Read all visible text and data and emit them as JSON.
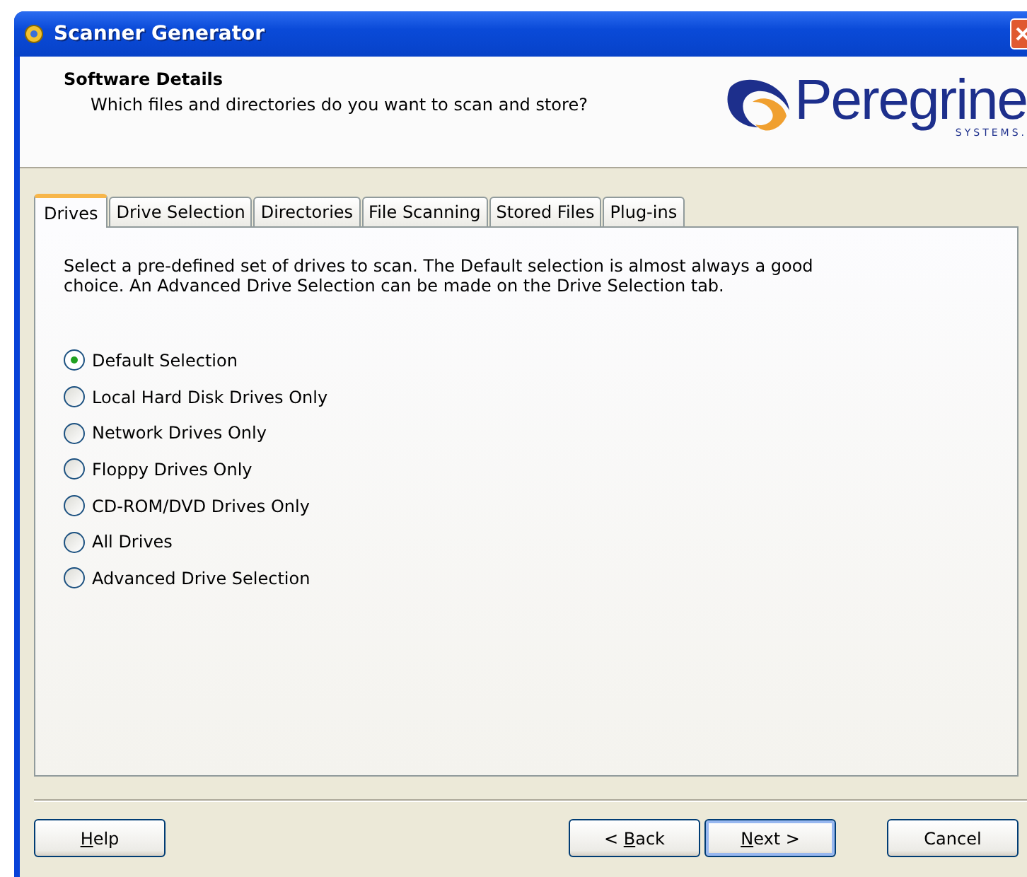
{
  "window": {
    "title": "Scanner Generator"
  },
  "header": {
    "title": "Software Details",
    "subtitle": "Which files and directories do you want to scan and store?",
    "logo": {
      "name": "Peregrine",
      "tagline": "SYSTEMS."
    }
  },
  "tabs": [
    {
      "label": "Drives",
      "selected": true
    },
    {
      "label": "Drive Selection",
      "selected": false
    },
    {
      "label": "Directories",
      "selected": false
    },
    {
      "label": "File Scanning",
      "selected": false
    },
    {
      "label": "Stored Files",
      "selected": false
    },
    {
      "label": "Plug-ins",
      "selected": false
    }
  ],
  "description": "Select a pre-defined set of drives to scan.  The Default selection is almost always a good choice.  An Advanced Drive Selection can be made on the Drive Selection tab.",
  "options": [
    {
      "label": "Default Selection",
      "selected": true
    },
    {
      "label": "Local Hard Disk Drives Only",
      "selected": false
    },
    {
      "label": "Network Drives Only",
      "selected": false
    },
    {
      "label": "Floppy Drives Only",
      "selected": false
    },
    {
      "label": "CD-ROM/DVD Drives Only",
      "selected": false
    },
    {
      "label": "All Drives",
      "selected": false
    },
    {
      "label": "Advanced Drive Selection",
      "selected": false
    }
  ],
  "buttons": [
    {
      "key": "H",
      "after": "elp",
      "default": false
    },
    {
      "before": "< ",
      "key": "B",
      "after": "ack",
      "default": false
    },
    {
      "key": "N",
      "after": "ext >",
      "default": true
    },
    {
      "after": "Cancel",
      "default": false
    }
  ]
}
